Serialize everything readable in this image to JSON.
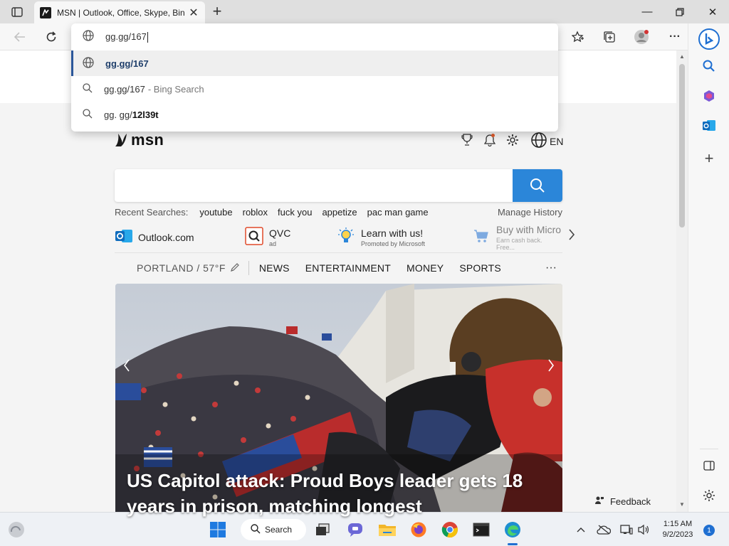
{
  "browser": {
    "tab_title": "MSN | Outlook, Office, Skype, Bing",
    "omnibox": {
      "typed_text": "gg.gg/167",
      "suggestions": [
        {
          "kind": "url",
          "text": "gg.gg/167",
          "hint": ""
        },
        {
          "kind": "search",
          "text": "gg.gg/167",
          "hint": "- Bing Search"
        },
        {
          "kind": "search",
          "prefix": "gg. gg/",
          "text": "12l39t",
          "hint": ""
        }
      ]
    }
  },
  "msn": {
    "logo_text": "msn",
    "language": "EN",
    "recent_label": "Recent Searches:",
    "recent_searches": [
      "youtube",
      "roblox",
      "fuck you",
      "appetize",
      "pac man game"
    ],
    "manage_history": "Manage History",
    "quick_links": [
      {
        "name": "Outlook.com",
        "sub": ""
      },
      {
        "name": "QVC",
        "sub": "ad"
      },
      {
        "name": "Learn with us!",
        "sub": "Promoted by Microsoft"
      },
      {
        "name": "Buy with Micro",
        "sub": "Earn cash back. Free..."
      }
    ],
    "location": "PORTLAND / 57°F",
    "categories": [
      "NEWS",
      "ENTERTAINMENT",
      "MONEY",
      "SPORTS"
    ],
    "more": "···",
    "headline": "US Capitol attack: Proud Boys leader gets 18 years in prison, matching longest",
    "feedback": "Feedback"
  },
  "taskbar": {
    "search_label": "Search",
    "time": "1:15 AM",
    "date": "9/2/2023",
    "notification_count": "1"
  },
  "colors": {
    "accent": "#2b86d9",
    "selected_border": "#2b579a"
  }
}
